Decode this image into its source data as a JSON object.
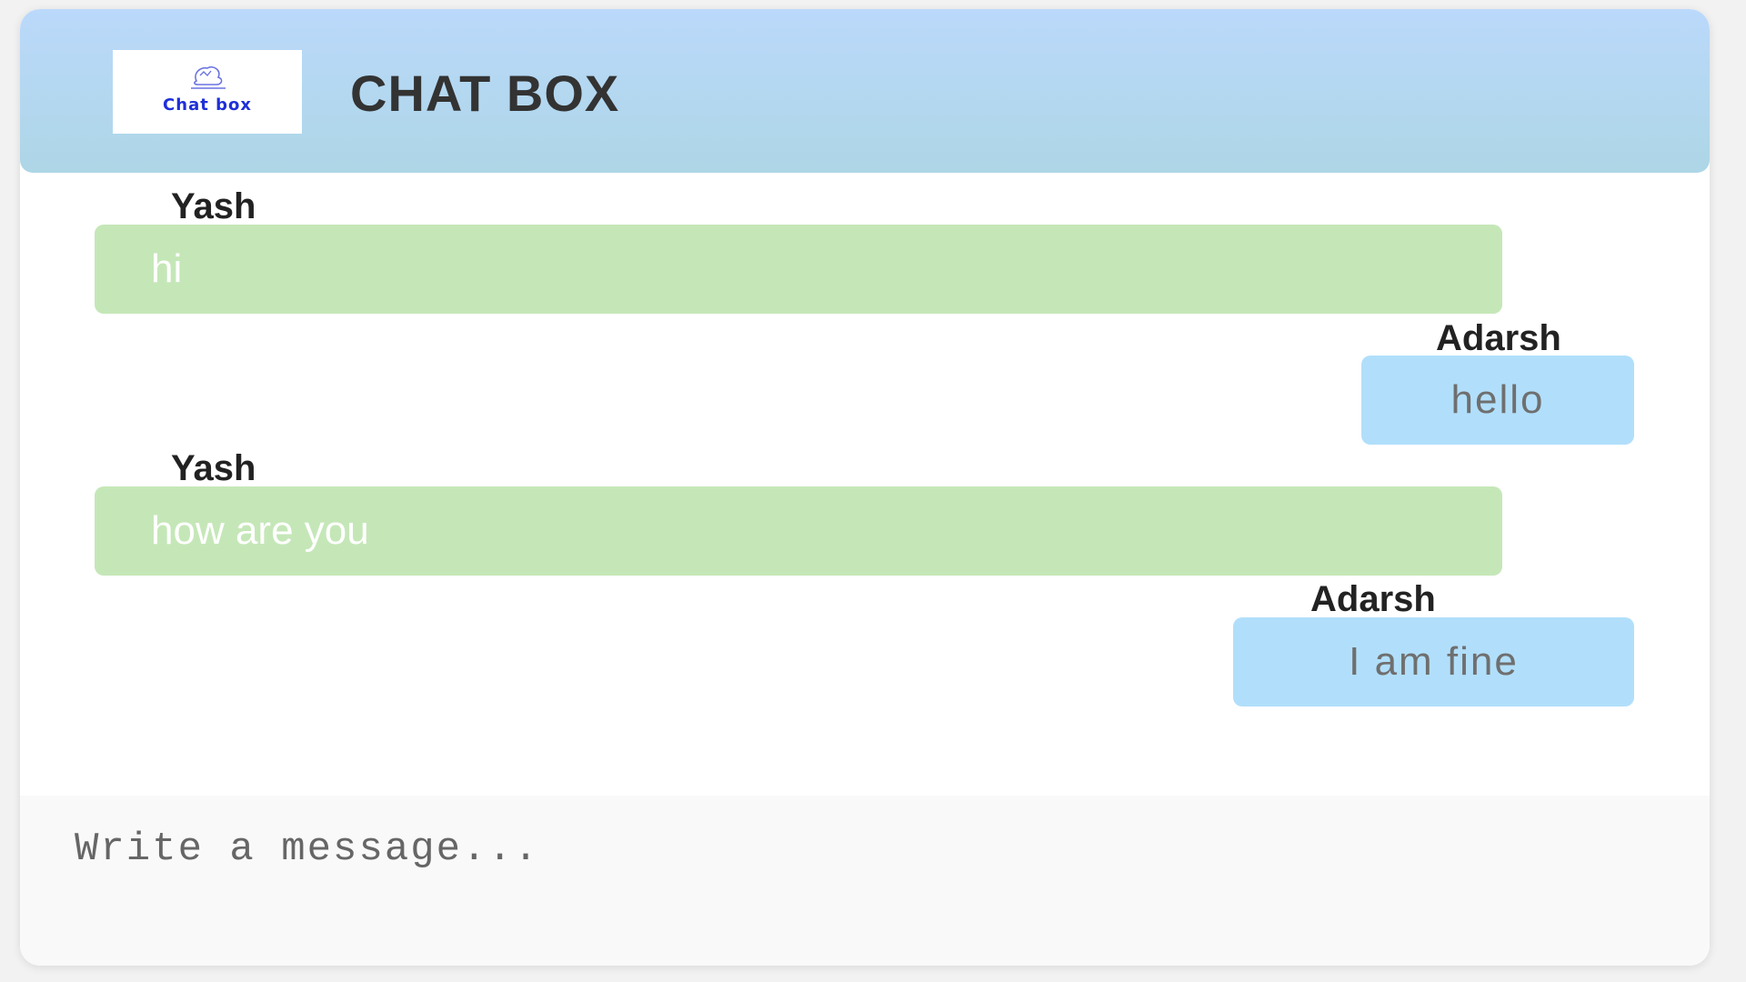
{
  "header": {
    "logo_text": "Chat box",
    "title": "CHAT BOX"
  },
  "messages": [
    {
      "sender": "Yash",
      "text": "hi",
      "side": "left"
    },
    {
      "sender": "Adarsh",
      "text": "hello",
      "side": "right"
    },
    {
      "sender": "Yash",
      "text": "how are you",
      "side": "left"
    },
    {
      "sender": "Adarsh",
      "text": "I am fine",
      "side": "right"
    }
  ],
  "composer": {
    "placeholder": "Write a message...",
    "value": ""
  },
  "colors": {
    "header_top": "#bbd9fb",
    "header_bottom": "#add6e6",
    "left_bubble": "#c5e7b8",
    "right_bubble": "#b1dffb",
    "logo_text": "#1e2fd8"
  }
}
